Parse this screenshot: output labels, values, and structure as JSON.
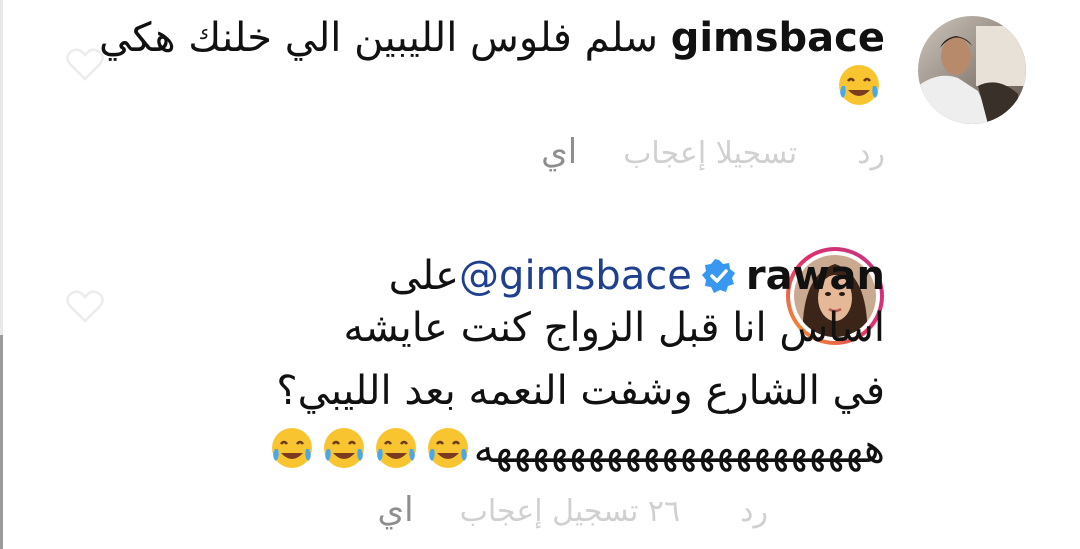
{
  "comments": [
    {
      "username": "gimsbace",
      "text_line1": "سلم فلوس الليبين الي خلنك هكي",
      "actions": {
        "likes": "تسجيلا إعجاب",
        "reply": "رد",
        "more": "اي"
      }
    },
    {
      "username": "rawan",
      "mention": "@gimsbace",
      "mention_prefix": "على",
      "text_line1": "اساس انا قبل الزواج كنت عايشه",
      "text_line2": "في الشارع وشفت النعمه بعد الليبي؟",
      "text_line3": "هههههههههههههههههههههه",
      "actions": {
        "likes": "٢٦ تسجيل إعجاب",
        "reply": "رد",
        "more": "اي"
      }
    }
  ],
  "colors": {
    "mention": "#1f3f8f",
    "verified": "#3897f0",
    "story_ring_start": "#f5a623",
    "story_ring_end": "#c13584"
  }
}
